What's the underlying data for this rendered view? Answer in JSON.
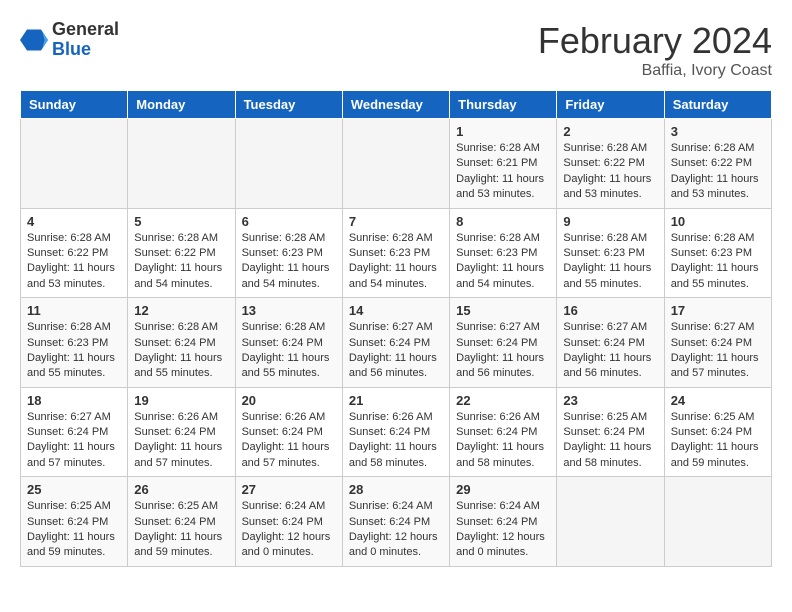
{
  "header": {
    "logo_general": "General",
    "logo_blue": "Blue",
    "title": "February 2024",
    "subtitle": "Baffia, Ivory Coast"
  },
  "days_of_week": [
    "Sunday",
    "Monday",
    "Tuesday",
    "Wednesday",
    "Thursday",
    "Friday",
    "Saturday"
  ],
  "weeks": [
    [
      {
        "day": "",
        "info": ""
      },
      {
        "day": "",
        "info": ""
      },
      {
        "day": "",
        "info": ""
      },
      {
        "day": "",
        "info": ""
      },
      {
        "day": "1",
        "info": "Sunrise: 6:28 AM\nSunset: 6:21 PM\nDaylight: 11 hours\nand 53 minutes."
      },
      {
        "day": "2",
        "info": "Sunrise: 6:28 AM\nSunset: 6:22 PM\nDaylight: 11 hours\nand 53 minutes."
      },
      {
        "day": "3",
        "info": "Sunrise: 6:28 AM\nSunset: 6:22 PM\nDaylight: 11 hours\nand 53 minutes."
      }
    ],
    [
      {
        "day": "4",
        "info": "Sunrise: 6:28 AM\nSunset: 6:22 PM\nDaylight: 11 hours\nand 53 minutes."
      },
      {
        "day": "5",
        "info": "Sunrise: 6:28 AM\nSunset: 6:22 PM\nDaylight: 11 hours\nand 54 minutes."
      },
      {
        "day": "6",
        "info": "Sunrise: 6:28 AM\nSunset: 6:23 PM\nDaylight: 11 hours\nand 54 minutes."
      },
      {
        "day": "7",
        "info": "Sunrise: 6:28 AM\nSunset: 6:23 PM\nDaylight: 11 hours\nand 54 minutes."
      },
      {
        "day": "8",
        "info": "Sunrise: 6:28 AM\nSunset: 6:23 PM\nDaylight: 11 hours\nand 54 minutes."
      },
      {
        "day": "9",
        "info": "Sunrise: 6:28 AM\nSunset: 6:23 PM\nDaylight: 11 hours\nand 55 minutes."
      },
      {
        "day": "10",
        "info": "Sunrise: 6:28 AM\nSunset: 6:23 PM\nDaylight: 11 hours\nand 55 minutes."
      }
    ],
    [
      {
        "day": "11",
        "info": "Sunrise: 6:28 AM\nSunset: 6:23 PM\nDaylight: 11 hours\nand 55 minutes."
      },
      {
        "day": "12",
        "info": "Sunrise: 6:28 AM\nSunset: 6:24 PM\nDaylight: 11 hours\nand 55 minutes."
      },
      {
        "day": "13",
        "info": "Sunrise: 6:28 AM\nSunset: 6:24 PM\nDaylight: 11 hours\nand 55 minutes."
      },
      {
        "day": "14",
        "info": "Sunrise: 6:27 AM\nSunset: 6:24 PM\nDaylight: 11 hours\nand 56 minutes."
      },
      {
        "day": "15",
        "info": "Sunrise: 6:27 AM\nSunset: 6:24 PM\nDaylight: 11 hours\nand 56 minutes."
      },
      {
        "day": "16",
        "info": "Sunrise: 6:27 AM\nSunset: 6:24 PM\nDaylight: 11 hours\nand 56 minutes."
      },
      {
        "day": "17",
        "info": "Sunrise: 6:27 AM\nSunset: 6:24 PM\nDaylight: 11 hours\nand 57 minutes."
      }
    ],
    [
      {
        "day": "18",
        "info": "Sunrise: 6:27 AM\nSunset: 6:24 PM\nDaylight: 11 hours\nand 57 minutes."
      },
      {
        "day": "19",
        "info": "Sunrise: 6:26 AM\nSunset: 6:24 PM\nDaylight: 11 hours\nand 57 minutes."
      },
      {
        "day": "20",
        "info": "Sunrise: 6:26 AM\nSunset: 6:24 PM\nDaylight: 11 hours\nand 57 minutes."
      },
      {
        "day": "21",
        "info": "Sunrise: 6:26 AM\nSunset: 6:24 PM\nDaylight: 11 hours\nand 58 minutes."
      },
      {
        "day": "22",
        "info": "Sunrise: 6:26 AM\nSunset: 6:24 PM\nDaylight: 11 hours\nand 58 minutes."
      },
      {
        "day": "23",
        "info": "Sunrise: 6:25 AM\nSunset: 6:24 PM\nDaylight: 11 hours\nand 58 minutes."
      },
      {
        "day": "24",
        "info": "Sunrise: 6:25 AM\nSunset: 6:24 PM\nDaylight: 11 hours\nand 59 minutes."
      }
    ],
    [
      {
        "day": "25",
        "info": "Sunrise: 6:25 AM\nSunset: 6:24 PM\nDaylight: 11 hours\nand 59 minutes."
      },
      {
        "day": "26",
        "info": "Sunrise: 6:25 AM\nSunset: 6:24 PM\nDaylight: 11 hours\nand 59 minutes."
      },
      {
        "day": "27",
        "info": "Sunrise: 6:24 AM\nSunset: 6:24 PM\nDaylight: 12 hours\nand 0 minutes."
      },
      {
        "day": "28",
        "info": "Sunrise: 6:24 AM\nSunset: 6:24 PM\nDaylight: 12 hours\nand 0 minutes."
      },
      {
        "day": "29",
        "info": "Sunrise: 6:24 AM\nSunset: 6:24 PM\nDaylight: 12 hours\nand 0 minutes."
      },
      {
        "day": "",
        "info": ""
      },
      {
        "day": "",
        "info": ""
      }
    ]
  ]
}
